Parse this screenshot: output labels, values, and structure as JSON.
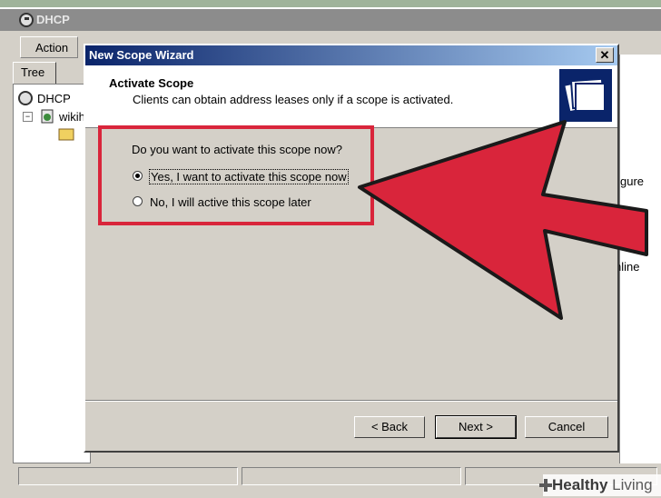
{
  "background_app": {
    "title": "DHCP",
    "menu_action": "Action",
    "tab_tree": "Tree",
    "tree": {
      "root_label": "DHCP",
      "server_label": "wikih"
    },
    "right_pane_fragments": [
      "gure",
      "nline"
    ]
  },
  "dialog": {
    "title": "New Scope Wizard",
    "close_glyph": "✕",
    "header": {
      "title": "Activate Scope",
      "subtitle": "Clients can obtain address leases only if a scope is activated."
    },
    "question": "Do you want to activate this scope now?",
    "options": [
      {
        "label": "Yes, I want to activate this scope now",
        "selected": true
      },
      {
        "label": "No, I will active this scope later",
        "selected": false
      }
    ],
    "buttons": {
      "back": "< Back",
      "next": "Next >",
      "cancel": "Cancel"
    }
  },
  "overlay": {
    "highlight_color": "#d9253b",
    "arrow_color": "#d9253b"
  },
  "watermark": {
    "brand": "Healthy",
    "brand_suffix": "Living"
  }
}
